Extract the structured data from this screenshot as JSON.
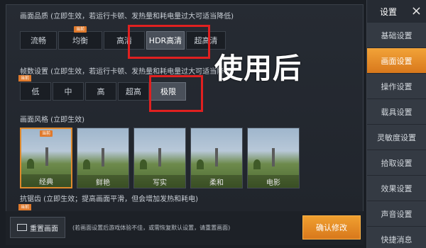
{
  "quality": {
    "title": "画面品质 (立即生效，若运行卡顿、发热量和耗电量过大可适当降低)",
    "options": [
      "流畅",
      "均衡",
      "高清",
      "HDR高清",
      "超高清"
    ],
    "selected": "HDR高清",
    "tag": "当前"
  },
  "framerate": {
    "title": "帧数设置 (立即生效，若运行卡顿、发热量和耗电量过大可适当降低)",
    "options": [
      "低",
      "中",
      "高",
      "超高",
      "极限"
    ],
    "selected": "极限",
    "tag": "当前"
  },
  "style": {
    "title": "画面风格 (立即生效)",
    "options": [
      "经典",
      "鲜艳",
      "写实",
      "柔和",
      "电影"
    ],
    "selected": "经典",
    "tag": "当前"
  },
  "aa": {
    "title": "抗锯齿 (立即生效；提高画面平滑，但会增加发热和耗电)",
    "tag": "当前"
  },
  "footer": {
    "reset_label": "重置画面",
    "hint": "(若画面设置后游戏体验不佳，或需恢复默认设置，请重置画面)",
    "confirm_label": "确认修改"
  },
  "annotation": "使用后",
  "sidebar": {
    "title": "设置",
    "close": "×",
    "items": [
      "基础设置",
      "画面设置",
      "操作设置",
      "载具设置",
      "灵敏度设置",
      "拾取设置",
      "效果设置",
      "声音设置",
      "快捷消息"
    ],
    "active": "画面设置"
  },
  "colors": {
    "accent": "#e07a2c",
    "highlight": "#e02020"
  }
}
